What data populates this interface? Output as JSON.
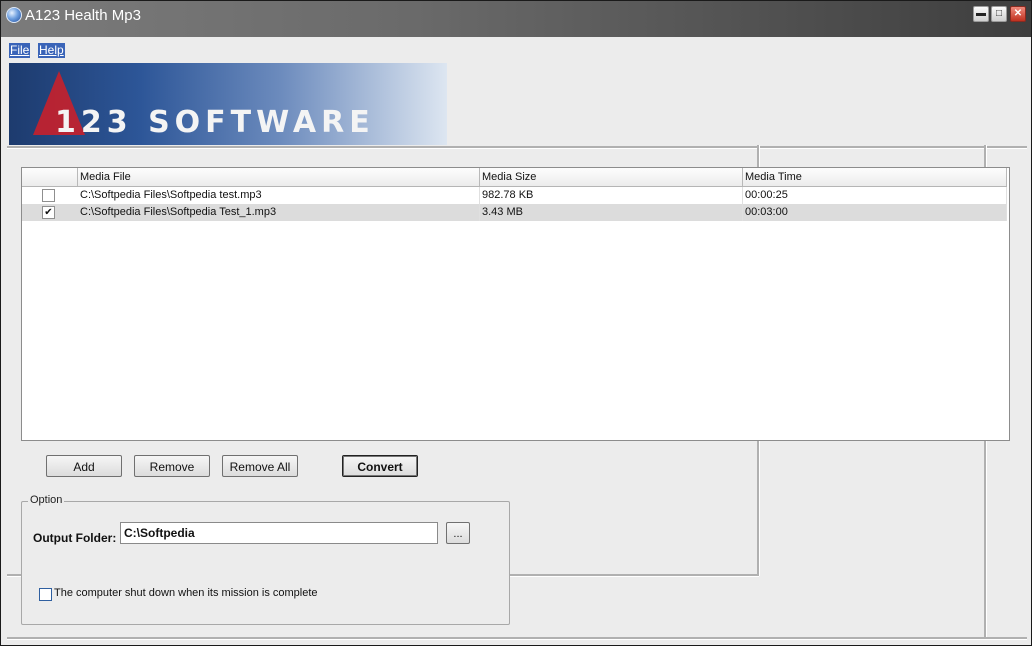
{
  "window": {
    "title": "A123 Health Mp3",
    "controls": {
      "minimize": "▬",
      "maximize": "□",
      "close": "✕"
    }
  },
  "menu": [
    {
      "label": "File"
    },
    {
      "label": "Help"
    }
  ],
  "banner": {
    "text": "123 SOFTWARE",
    "accent_color": "#c8202b"
  },
  "table": {
    "columns": [
      "Media File",
      "Media Size",
      "Media Time"
    ],
    "rows": [
      {
        "checked": false,
        "file": "C:\\Softpedia Files\\Softpedia test.mp3",
        "size": "982.78 KB",
        "time": "00:00:25"
      },
      {
        "checked": true,
        "file": "C:\\Softpedia Files\\Softpedia Test_1.mp3",
        "size": "3.43 MB",
        "time": "00:03:00"
      }
    ]
  },
  "buttons": {
    "add": "Add",
    "remove": "Remove",
    "remove_all": "Remove All",
    "convert": "Convert"
  },
  "options": {
    "group_title": "Option",
    "output_folder_label": "Output Folder:",
    "output_folder_value": "C:\\Softpedia",
    "browse_label": "...",
    "shutdown_label": "The computer shut down when its mission is complete",
    "shutdown_checked": false
  }
}
